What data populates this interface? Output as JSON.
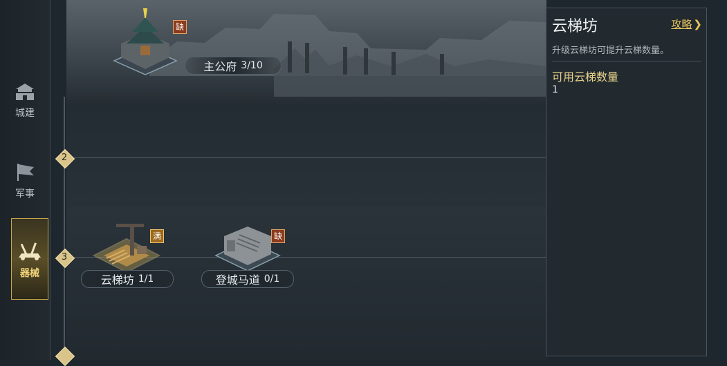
{
  "sidebar": {
    "items": [
      {
        "label": "城建",
        "icon": "city-gate-icon"
      },
      {
        "label": "军事",
        "icon": "battle-flag-icon"
      },
      {
        "label": "器械",
        "icon": "siege-weapon-icon"
      }
    ],
    "active_index": 2
  },
  "header_building": {
    "name": "主公府",
    "count": "3/10",
    "badge": "缺"
  },
  "tiers": [
    {
      "number": "2"
    },
    {
      "number": "3"
    }
  ],
  "tier3_buildings": [
    {
      "name": "云梯坊",
      "count": "1/1",
      "badge": "满"
    },
    {
      "name": "登城马道",
      "count": "0/1",
      "badge": "缺"
    }
  ],
  "panel": {
    "title": "云梯坊",
    "guide_label": "攻略",
    "guide_icon": "chevron-right-icon",
    "description": "升级云梯坊可提升云梯数量。",
    "stat_label": "可用云梯数量",
    "stat_value": "1"
  },
  "colors": {
    "accent_gold": "#e8c45a",
    "badge_lack": "#8c3b1d",
    "badge_full": "#9b6a20"
  }
}
